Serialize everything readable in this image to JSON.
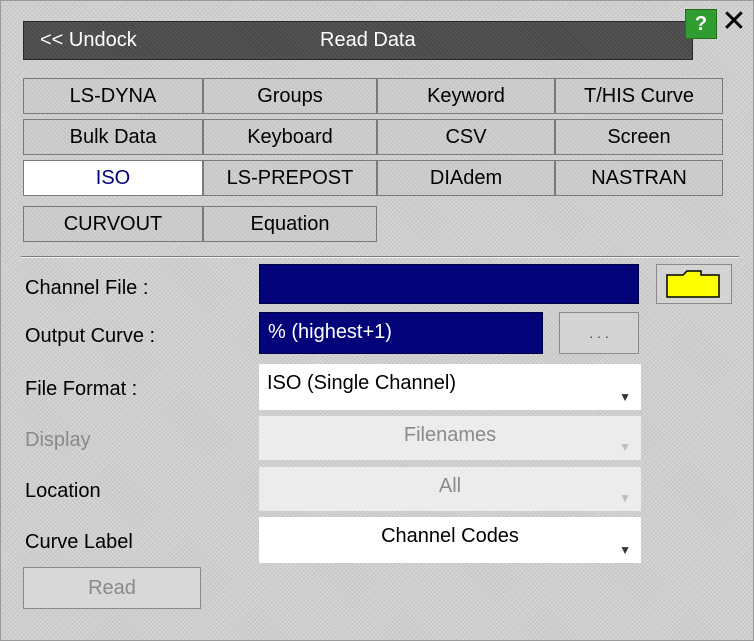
{
  "window": {
    "undock_label": "<< Undock",
    "title": "Read Data",
    "help_label": "?",
    "close_label": "✕"
  },
  "tabs": [
    {
      "label": "LS-DYNA",
      "active": false
    },
    {
      "label": "Groups",
      "active": false
    },
    {
      "label": "Keyword",
      "active": false
    },
    {
      "label": "T/HIS Curve",
      "active": false
    },
    {
      "label": "Bulk Data",
      "active": false
    },
    {
      "label": "Keyboard",
      "active": false
    },
    {
      "label": "CSV",
      "active": false
    },
    {
      "label": "Screen",
      "active": false
    },
    {
      "label": "ISO",
      "active": true
    },
    {
      "label": "LS-PREPOST",
      "active": false
    },
    {
      "label": "DIAdem",
      "active": false
    },
    {
      "label": "NASTRAN",
      "active": false
    },
    {
      "label": "CURVOUT",
      "active": false
    },
    {
      "label": "Equation",
      "active": false
    }
  ],
  "form": {
    "channel_file": {
      "label": "Channel File :",
      "value": ""
    },
    "output_curve": {
      "label": "Output Curve :",
      "value": "% (highest+1)",
      "browse_label": ". . ."
    },
    "file_format": {
      "label": "File Format :",
      "value": "ISO (Single Channel)"
    },
    "display": {
      "label": "Display",
      "value": "Filenames",
      "enabled": false
    },
    "location": {
      "label": "Location",
      "value": "All",
      "enabled": false
    },
    "curve_label": {
      "label": "Curve Label",
      "value": "Channel Codes"
    }
  },
  "actions": {
    "read_label": "Read",
    "read_enabled": false
  },
  "icons": {
    "folder": "folder-icon",
    "dropdown": "dropdown-arrow-icon"
  },
  "colors": {
    "titlebar_bg": "#4a4a4a",
    "dark_field_bg": "#03037a",
    "help_green": "#2f9d2f",
    "folder_yellow": "#ffff00",
    "active_tab_text": "#00007a"
  }
}
